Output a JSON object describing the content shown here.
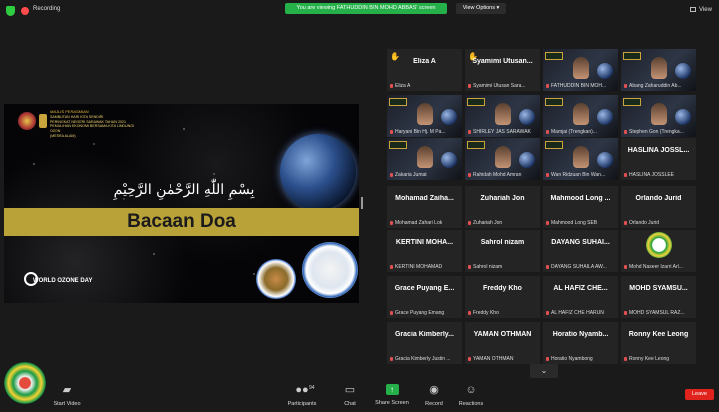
{
  "topbar": {
    "recording_label": "Recording",
    "viewing_banner": "You are viewing FATHUDDIN BIN MOHD ABBAS' screen",
    "view_options_label": "View Options",
    "view_label": "View"
  },
  "slide": {
    "header_lines": [
      "Majlis Perasmian",
      "SAMBUTAN HARI KITA SENDIRI",
      "PERINGKAT NEGERI SARAWAK TAHUN 2021",
      "PEMULIHAN EKONOMI BERSAMA KITA LINDUNGI OZON",
      "(MESRA ALAM)"
    ],
    "arabic_text": "بِسْمِ اللّٰهِ الرَّحْمٰنِ الرَّحِيْمِ",
    "title": "Bacaan Doa",
    "footer": "WORLD OZONE DAY"
  },
  "gallery": {
    "tiles": [
      {
        "big": "Eliza A",
        "small": "Eliza A",
        "type": "name",
        "hand": true
      },
      {
        "big": "Syamimi  Utusan...",
        "small": "Syamimi Utusan Sara...",
        "type": "name",
        "hand": true
      },
      {
        "big": "",
        "small": "FATHUDDIN BIN MOH...",
        "type": "video"
      },
      {
        "big": "",
        "small": "Abang Zaharuddin Ab...",
        "type": "video"
      },
      {
        "big": "",
        "small": "Haryani Bin Hj. M Pa...",
        "type": "video"
      },
      {
        "big": "",
        "small": "SHIRLEY JAS SARAWAK",
        "type": "video"
      },
      {
        "big": "",
        "small": "Mamjai (Trengkan)...",
        "type": "video"
      },
      {
        "big": "",
        "small": "Stephen Gon (Trengka...",
        "type": "video"
      },
      {
        "big": "",
        "small": "Zakaria Jumat",
        "type": "video",
        "active": true
      },
      {
        "big": "",
        "small": "Rahidah Mohd Amran",
        "type": "video"
      },
      {
        "big": "",
        "small": "Wan Ridzuan Bin Wan...",
        "type": "video"
      },
      {
        "big": "HASLINA  JOSSL...",
        "small": "HASLINA JOSSLEE",
        "type": "name"
      },
      {
        "big": "Mohamad  Zaiha...",
        "small": "Mohamad Zahari Lok",
        "type": "name"
      },
      {
        "big": "Zuhariah  Jon",
        "small": "Zuhariah Jon",
        "type": "name"
      },
      {
        "big": "Mahmood  Long ...",
        "small": "Mahmood Long SEB",
        "type": "name"
      },
      {
        "big": "Orlando  Jurid",
        "small": "Orlando Jurid",
        "type": "name"
      },
      {
        "big": "KERTINI  MOHA...",
        "small": "KERTINI MOHAMAD",
        "type": "name"
      },
      {
        "big": "Sahrol  nizam",
        "small": "Sahrol nizam",
        "type": "name"
      },
      {
        "big": "DAYANG  SUHAI...",
        "small": "DAYANG SUHAILA AW...",
        "type": "name"
      },
      {
        "big": "",
        "small": "Mohd Naseer Izarri Arl...",
        "type": "logo"
      },
      {
        "big": "Grace  Puyang  E...",
        "small": "Grace Puyang Emang",
        "type": "name"
      },
      {
        "big": "Freddy  Kho",
        "small": "Freddy Kho",
        "type": "name"
      },
      {
        "big": "AL HAFIZ  CHE...",
        "small": "AL HAFIZ CHE HARUN",
        "type": "name"
      },
      {
        "big": "MOHD  SYAMSU...",
        "small": "MOHD SYAMSUL RAZ...",
        "type": "name"
      },
      {
        "big": "Gracia  Kimberly...",
        "small": "Gracia Kimberly Justin ...",
        "type": "name"
      },
      {
        "big": "YAMAN  OTHMAN",
        "small": "YAMAN OTHMAN",
        "type": "name"
      },
      {
        "big": "Horatio  Nyamb...",
        "small": "Horatio Nyambong",
        "type": "name"
      },
      {
        "big": "Ronny  Kee  Leong",
        "small": "Ronny Kee Leong",
        "type": "name"
      }
    ]
  },
  "toolbar": {
    "start_video": "Start Video",
    "participants": "Participants",
    "participants_count": "94",
    "chat": "Chat",
    "share_screen": "Share Screen",
    "record": "Record",
    "reactions": "Reactions",
    "leave": "Leave"
  },
  "org_logo_text": "UNIMAS",
  "colors": {
    "accent_green": "#25b04a",
    "leave_red": "#e0241d",
    "active_speaker": "#e5e44a",
    "band_gold": "#b9a238"
  }
}
